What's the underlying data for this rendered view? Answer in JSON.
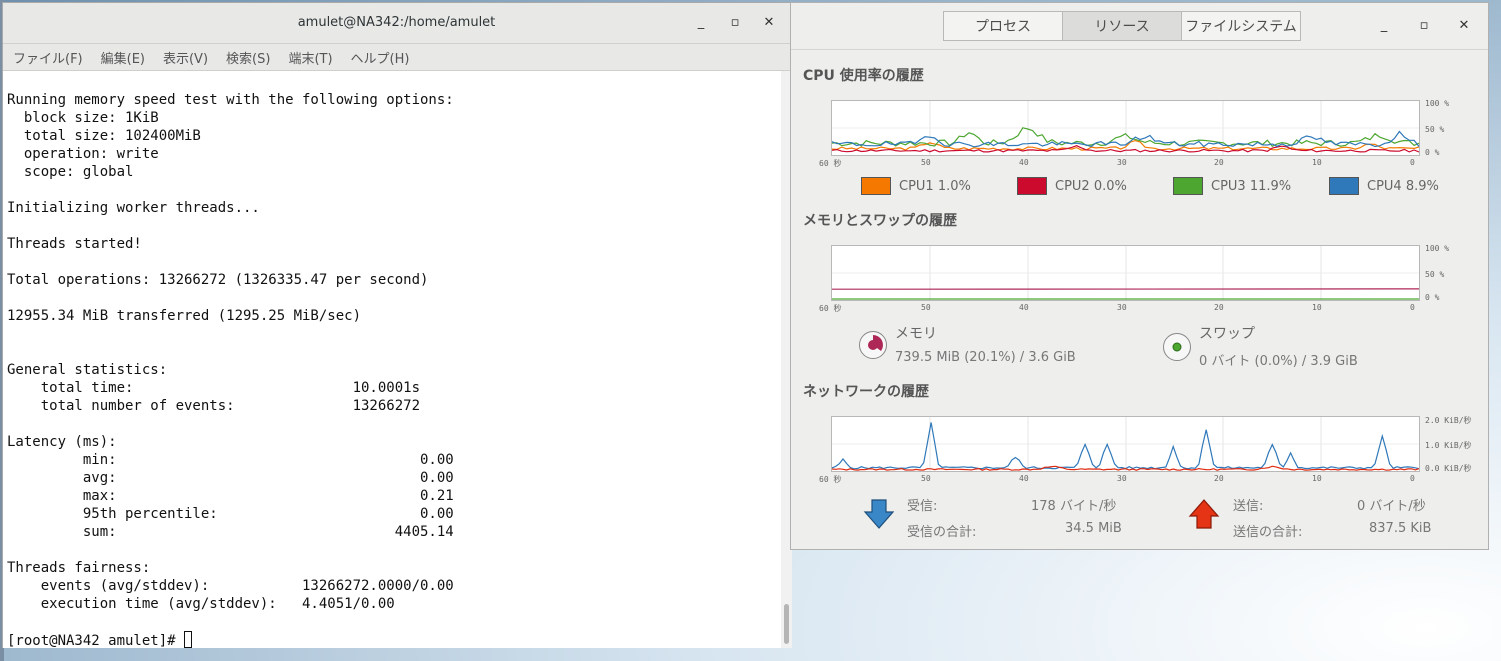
{
  "terminal": {
    "title": "amulet@NA342:/home/amulet",
    "menu": [
      "ファイル(F)",
      "編集(E)",
      "表示(V)",
      "検索(S)",
      "端末(T)",
      "ヘルプ(H)"
    ],
    "lines": [
      "Running memory speed test with the following options:",
      "  block size: 1KiB",
      "  total size: 102400MiB",
      "  operation: write",
      "  scope: global",
      "",
      "Initializing worker threads...",
      "",
      "Threads started!",
      "",
      "Total operations: 13266272 (1326335.47 per second)",
      "",
      "12955.34 MiB transferred (1295.25 MiB/sec)",
      "",
      "",
      "General statistics:",
      "    total time:                          10.0001s",
      "    total number of events:              13266272",
      "",
      "Latency (ms):",
      "         min:                                    0.00",
      "         avg:                                    0.00",
      "         max:                                    0.21",
      "         95th percentile:                        0.00",
      "         sum:                                 4405.14",
      "",
      "Threads fairness:",
      "    events (avg/stddev):           13266272.0000/0.00",
      "    execution time (avg/stddev):   4.4051/0.00",
      ""
    ],
    "prompt": "[root@NA342 amulet]# "
  },
  "monitor": {
    "tabs": [
      "プロセス",
      "リソース",
      "ファイルシステム"
    ],
    "active_tab": "リソース",
    "cpu": {
      "title": "CPU 使用率の履歴",
      "yticks": [
        "100 %",
        "50 %",
        "0 %"
      ],
      "xticks": [
        "60 秒",
        "50",
        "40",
        "30",
        "20",
        "10",
        "0"
      ],
      "legend": [
        {
          "label": "CPU1 1.0%",
          "color": "#f57900"
        },
        {
          "label": "CPU2 0.0%",
          "color": "#cc0a2e"
        },
        {
          "label": "CPU3 11.9%",
          "color": "#4ca630"
        },
        {
          "label": "CPU4 8.9%",
          "color": "#2f78b9"
        }
      ]
    },
    "memory": {
      "title": "メモリとスワップの履歴",
      "yticks": [
        "100 %",
        "50 %",
        "0 %"
      ],
      "xticks": [
        "60 秒",
        "50",
        "40",
        "30",
        "20",
        "10",
        "0"
      ],
      "mem_label": "メモリ",
      "mem_value": "739.5 MiB (20.1%) / 3.6 GiB",
      "swap_label": "スワップ",
      "swap_value": "0 バイト (0.0%) / 3.9 GiB",
      "mem_color": "#ad2757",
      "swap_color": "#4ca630"
    },
    "network": {
      "title": "ネットワークの履歴",
      "yticks": [
        "2.0 KiB/秒",
        "1.0 KiB/秒",
        "0.0 KiB/秒"
      ],
      "xticks": [
        "60 秒",
        "50",
        "40",
        "30",
        "20",
        "10",
        "0"
      ],
      "recv_label": "受信:",
      "recv_value": "178 バイト/秒",
      "recv_total_label": "受信の合計:",
      "recv_total_value": "34.5 MiB",
      "send_label": "送信:",
      "send_value": "0 バイト/秒",
      "send_total_label": "送信の合計:",
      "send_total_value": "837.5 KiB",
      "recv_color": "#2f78b9",
      "send_color": "#e02a10"
    }
  }
}
